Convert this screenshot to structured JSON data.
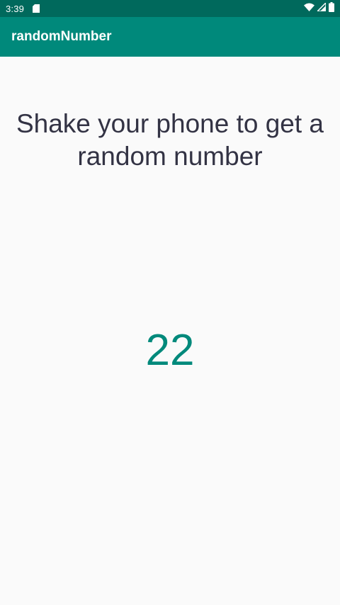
{
  "status_bar": {
    "time": "3:39",
    "icons": [
      "sd-card-icon",
      "wifi-icon",
      "cell-signal-icon",
      "battery-icon"
    ]
  },
  "app_bar": {
    "title": "randomNumber"
  },
  "main": {
    "instruction": "Shake your phone to get a random number",
    "number": "22"
  },
  "colors": {
    "status_bar": "#00695c",
    "app_bar": "#00897b",
    "background": "#fafafa",
    "instruction_text": "#333344",
    "number_text": "#00897b"
  }
}
